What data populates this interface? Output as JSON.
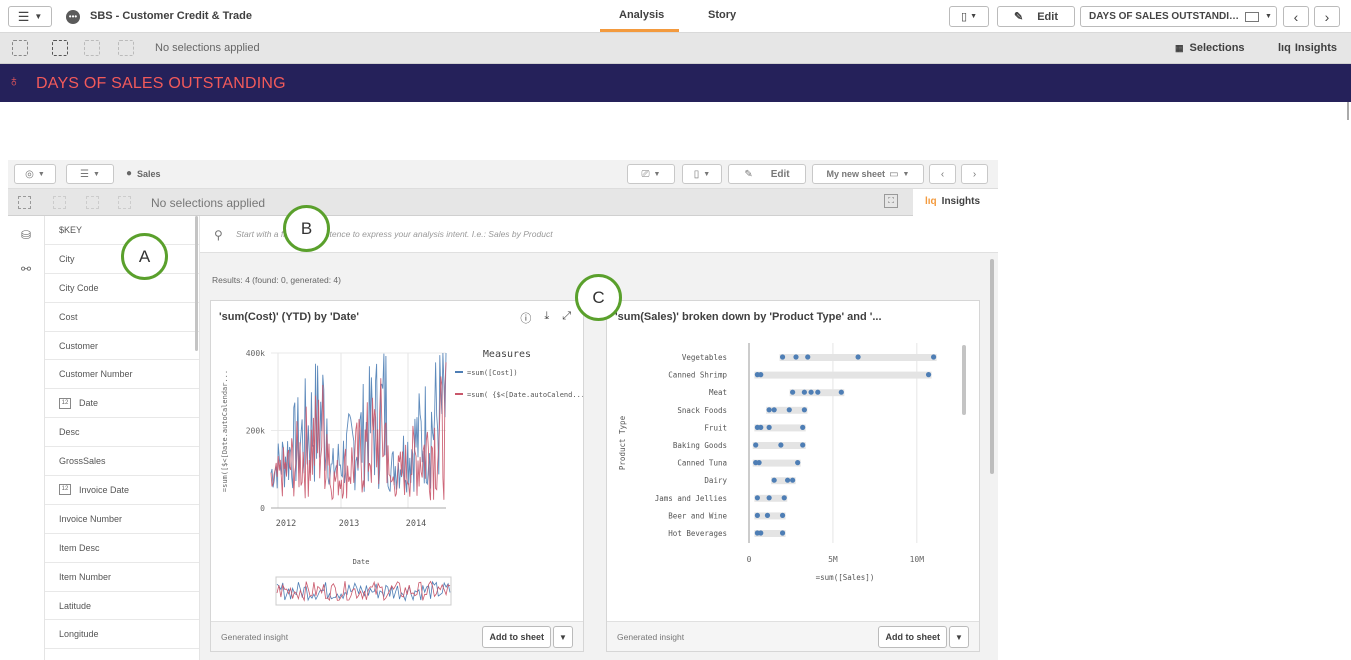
{
  "app": {
    "title": "SBS - Customer Credit & Trade",
    "tabs": [
      {
        "label": "Analysis",
        "active": true
      },
      {
        "label": "Story",
        "active": false
      }
    ],
    "edit_label": "Edit",
    "sheet_selector": "DAYS OF SALES OUTSTANDI…",
    "accent": "#f39a3e"
  },
  "selection_bar": {
    "text": "No selections applied",
    "selections_label": "Selections",
    "insights_label": "Insights"
  },
  "sheet": {
    "title": "DAYS OF SALES OUTSTANDING",
    "band_color": "#25215a",
    "title_color": "#f25a5a"
  },
  "embedded": {
    "app_name": "Sales",
    "edit_label": "Edit",
    "sheet_selector": "My new sheet",
    "selection_text": "No selections applied",
    "insights_label": "Insights",
    "fields": [
      {
        "label": "$KEY",
        "date": false
      },
      {
        "label": "City",
        "date": false
      },
      {
        "label": "City Code",
        "date": false
      },
      {
        "label": "Cost",
        "date": false
      },
      {
        "label": "Customer",
        "date": false
      },
      {
        "label": "Customer Number",
        "date": false
      },
      {
        "label": "Date",
        "date": true
      },
      {
        "label": "Desc",
        "date": false
      },
      {
        "label": "GrossSales",
        "date": false
      },
      {
        "label": "Invoice Date",
        "date": true
      },
      {
        "label": "Invoice Number",
        "date": false
      },
      {
        "label": "Item Desc",
        "date": false
      },
      {
        "label": "Item Number",
        "date": false
      },
      {
        "label": "Latitude",
        "date": false
      },
      {
        "label": "Longitude",
        "date": false
      }
    ],
    "search_placeholder": "Start with a field or a sentence to express your analysis intent. I.e.: Sales by Product",
    "results_text": "Results: 4 (found: 0, generated: 4)",
    "cards": [
      {
        "title": "'sum(Cost)' (YTD) by 'Date'",
        "footer": "Generated insight",
        "add_label": "Add to sheet"
      },
      {
        "title": "'sum(Sales)' broken down by 'Product Type' and '...",
        "footer": "Generated insight",
        "add_label": "Add to sheet"
      }
    ],
    "callouts": [
      "A",
      "B",
      "C"
    ]
  },
  "chart_data": [
    {
      "type": "line",
      "title": "'sum(Cost)' (YTD) by 'Date'",
      "xlabel": "Date",
      "ylabel": "=sum([$<[Date.autoCalendar...",
      "y_ticks": [
        "400k",
        "200k",
        "0"
      ],
      "x_ticks": [
        "2012",
        "2013",
        "2014"
      ],
      "ylim": [
        0,
        400000
      ],
      "legend_title": "Measures",
      "legend_position": "right",
      "series": [
        {
          "name": "=sum([Cost])",
          "color": "#4e7eb5"
        },
        {
          "name": "=sum( {$<[Date.autoCalend...",
          "color": "#c9576a"
        }
      ]
    },
    {
      "type": "scatter",
      "title": "'sum(Sales)' broken down by 'Product Type' and '...",
      "xlabel": "=sum([Sales])",
      "ylabel": "Product Type",
      "x_ticks": [
        {
          "label": "0",
          "value": 0
        },
        {
          "label": "5M",
          "value": 5000000
        },
        {
          "label": "10M",
          "value": 10000000
        }
      ],
      "xlim": [
        0,
        11500000
      ],
      "color": "#4e7eb5",
      "categories": [
        {
          "name": "Vegetables",
          "points": [
            2000000,
            2800000,
            3500000,
            6500000,
            11000000
          ]
        },
        {
          "name": "Canned Shrimp",
          "points": [
            500000,
            700000,
            10700000
          ]
        },
        {
          "name": "Meat",
          "points": [
            2600000,
            3300000,
            3700000,
            4100000,
            5500000
          ]
        },
        {
          "name": "Snack Foods",
          "points": [
            1200000,
            1500000,
            2400000,
            3300000
          ]
        },
        {
          "name": "Fruit",
          "points": [
            500000,
            700000,
            1200000,
            3200000
          ]
        },
        {
          "name": "Baking Goods",
          "points": [
            400000,
            1900000,
            3200000
          ]
        },
        {
          "name": "Canned Tuna",
          "points": [
            400000,
            600000,
            2900000
          ]
        },
        {
          "name": "Dairy",
          "points": [
            1500000,
            2300000,
            2600000
          ]
        },
        {
          "name": "Jams and Jellies",
          "points": [
            500000,
            1200000,
            2100000
          ]
        },
        {
          "name": "Beer and Wine",
          "points": [
            500000,
            1100000,
            2000000
          ]
        },
        {
          "name": "Hot Beverages",
          "points": [
            500000,
            700000,
            2000000
          ]
        }
      ]
    }
  ]
}
